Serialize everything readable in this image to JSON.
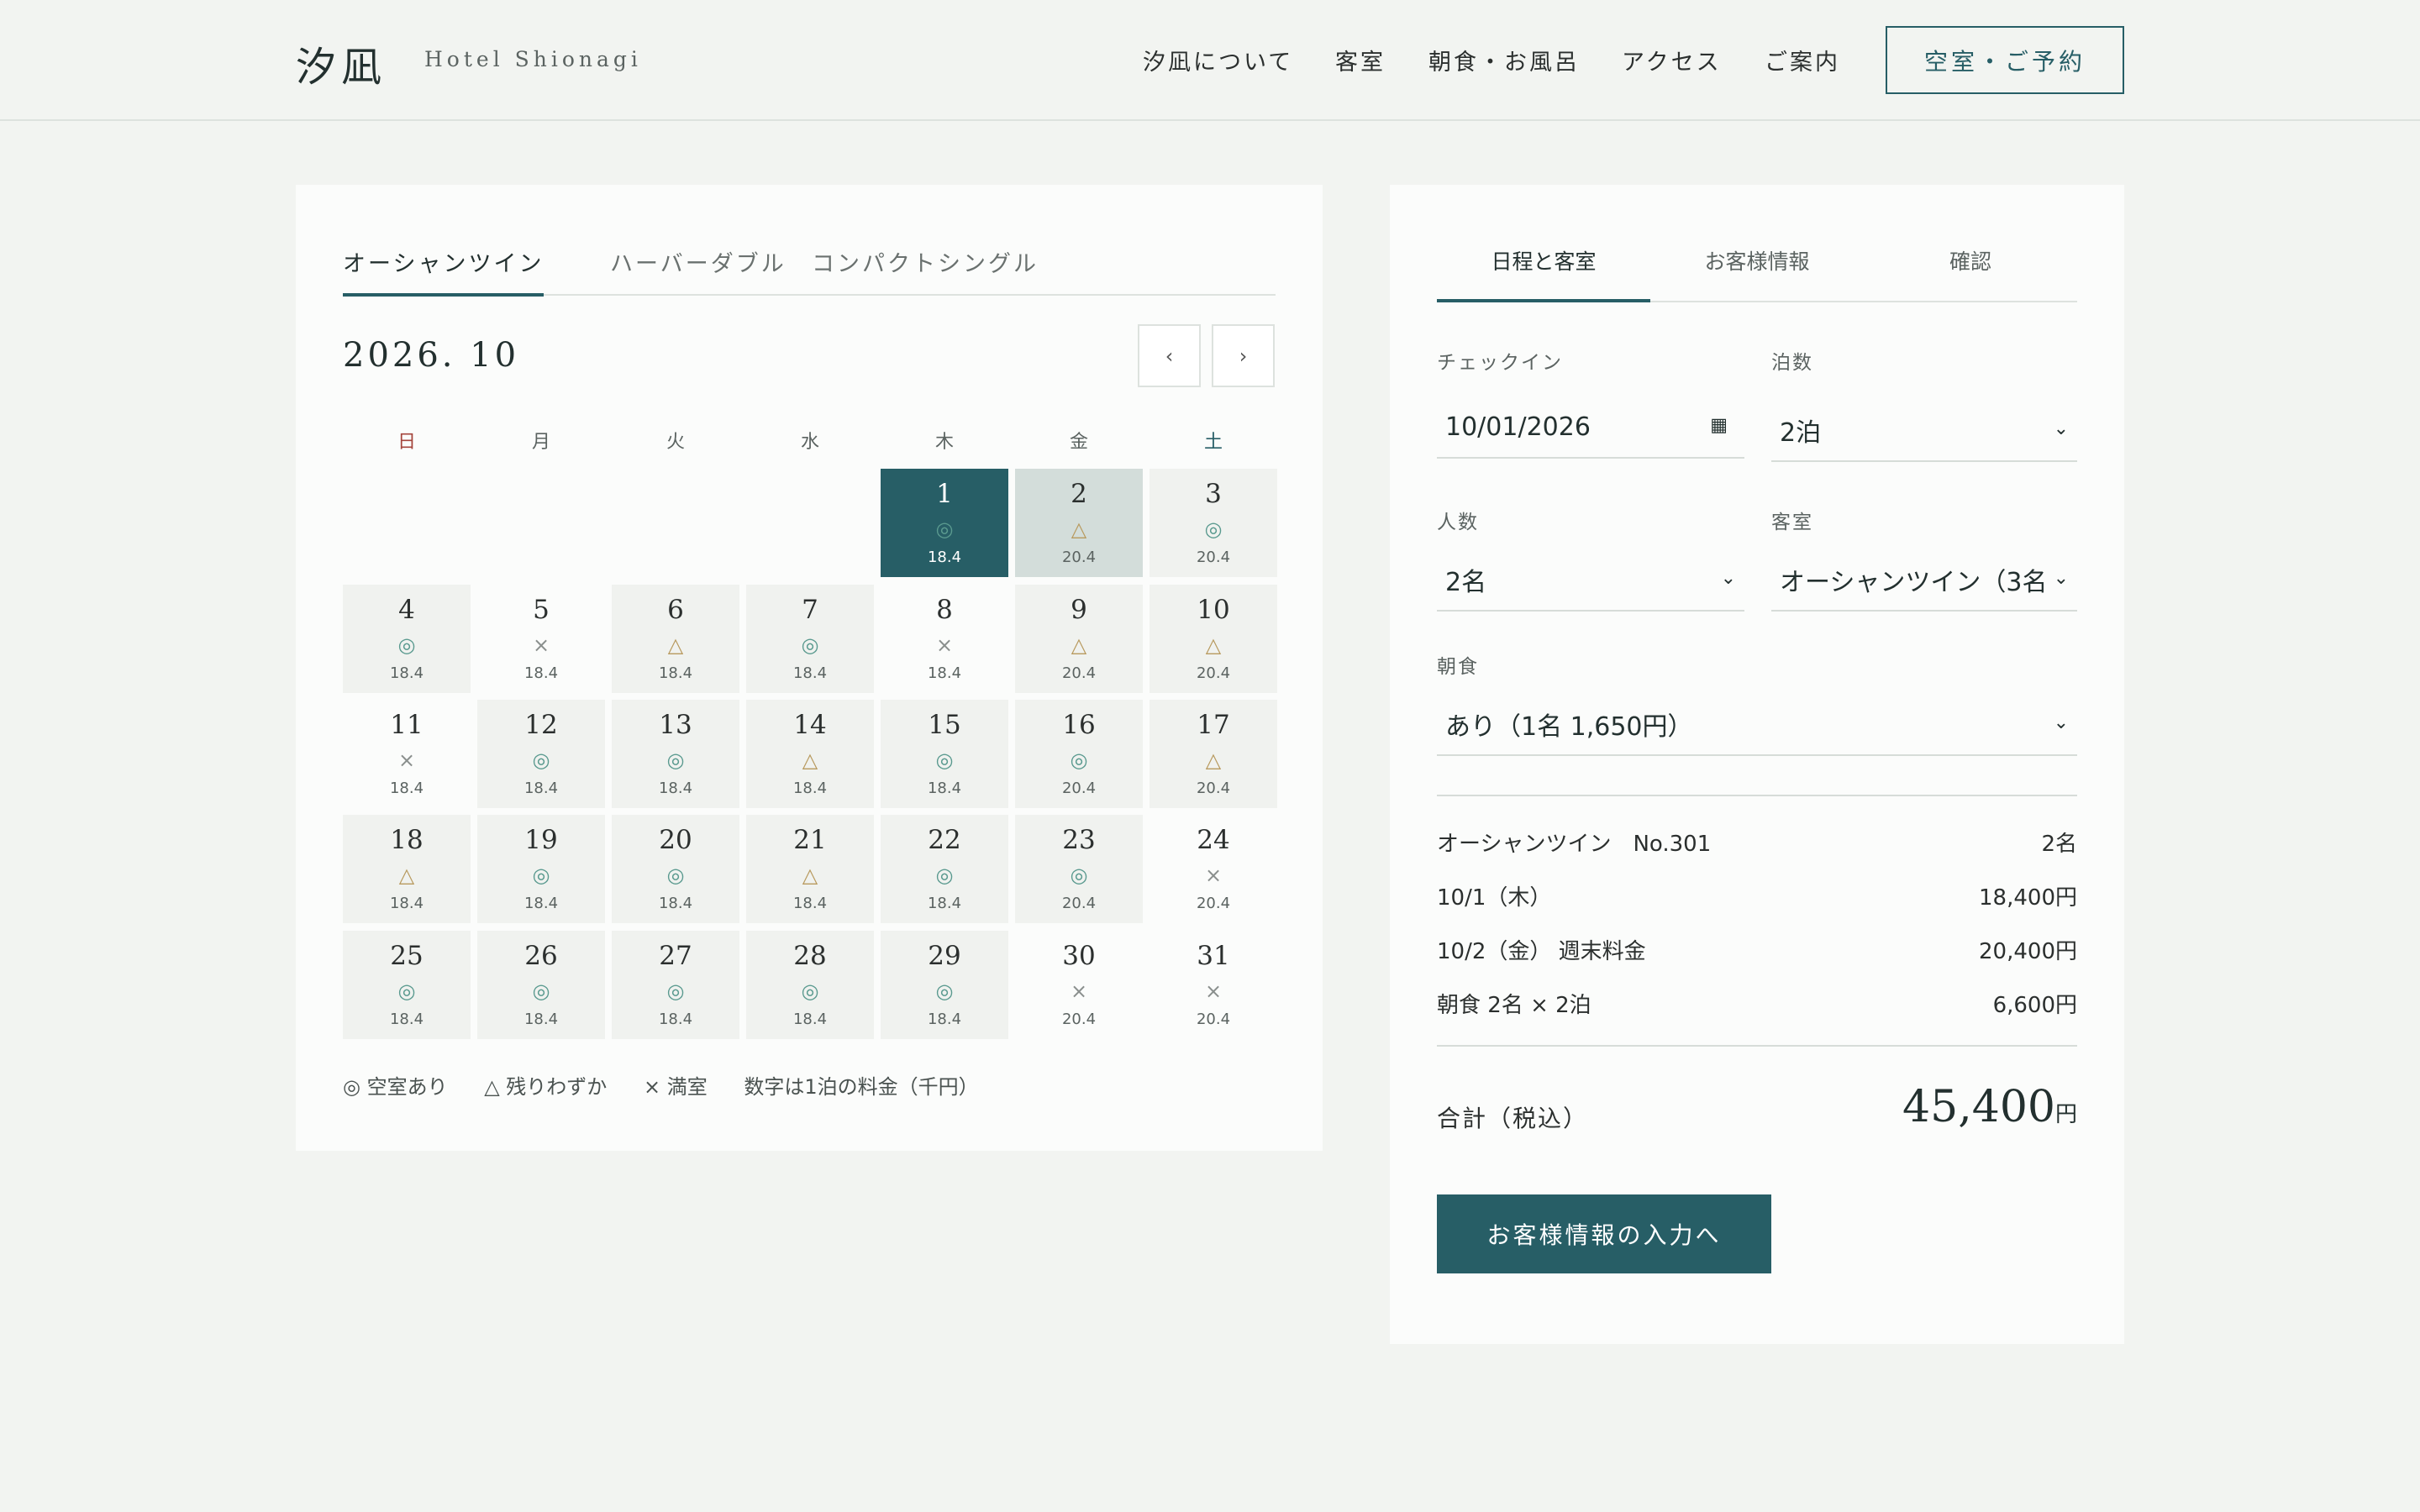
{
  "header": {
    "logo": "汐凪",
    "logo_sub": "Hotel Shionagi",
    "nav": [
      "汐凪について",
      "客室",
      "朝食・お風呂",
      "アクセス",
      "ご案内"
    ],
    "reserve": "空室・ご予約"
  },
  "calendar": {
    "room_tabs": [
      "オーシャンツイン",
      "ハーバーダブル",
      "コンパクトシングル"
    ],
    "month": "2026. 10",
    "prev": "‹",
    "next": "›",
    "weekdays": [
      "日",
      "月",
      "火",
      "水",
      "木",
      "金",
      "土"
    ],
    "days": [
      {
        "d": "1",
        "s": "◎",
        "p": "18.4",
        "state": "sel"
      },
      {
        "d": "2",
        "s": "△",
        "p": "20.4",
        "state": "range"
      },
      {
        "d": "3",
        "s": "◎",
        "p": "20.4",
        "state": "avail"
      },
      {
        "d": "4",
        "s": "◎",
        "p": "18.4",
        "state": "avail"
      },
      {
        "d": "5",
        "s": "×",
        "p": "18.4",
        "state": "full"
      },
      {
        "d": "6",
        "s": "△",
        "p": "18.4",
        "state": "avail"
      },
      {
        "d": "7",
        "s": "◎",
        "p": "18.4",
        "state": "avail"
      },
      {
        "d": "8",
        "s": "×",
        "p": "18.4",
        "state": "full"
      },
      {
        "d": "9",
        "s": "△",
        "p": "20.4",
        "state": "avail"
      },
      {
        "d": "10",
        "s": "△",
        "p": "20.4",
        "state": "avail"
      },
      {
        "d": "11",
        "s": "×",
        "p": "18.4",
        "state": "full"
      },
      {
        "d": "12",
        "s": "◎",
        "p": "18.4",
        "state": "avail"
      },
      {
        "d": "13",
        "s": "◎",
        "p": "18.4",
        "state": "avail"
      },
      {
        "d": "14",
        "s": "△",
        "p": "18.4",
        "state": "avail"
      },
      {
        "d": "15",
        "s": "◎",
        "p": "18.4",
        "state": "avail"
      },
      {
        "d": "16",
        "s": "◎",
        "p": "20.4",
        "state": "avail"
      },
      {
        "d": "17",
        "s": "△",
        "p": "20.4",
        "state": "avail"
      },
      {
        "d": "18",
        "s": "△",
        "p": "18.4",
        "state": "avail"
      },
      {
        "d": "19",
        "s": "◎",
        "p": "18.4",
        "state": "avail"
      },
      {
        "d": "20",
        "s": "◎",
        "p": "18.4",
        "state": "avail"
      },
      {
        "d": "21",
        "s": "△",
        "p": "18.4",
        "state": "avail"
      },
      {
        "d": "22",
        "s": "◎",
        "p": "18.4",
        "state": "avail"
      },
      {
        "d": "23",
        "s": "◎",
        "p": "20.4",
        "state": "avail"
      },
      {
        "d": "24",
        "s": "×",
        "p": "20.4",
        "state": "full"
      },
      {
        "d": "25",
        "s": "◎",
        "p": "18.4",
        "state": "avail"
      },
      {
        "d": "26",
        "s": "◎",
        "p": "18.4",
        "state": "avail"
      },
      {
        "d": "27",
        "s": "◎",
        "p": "18.4",
        "state": "avail"
      },
      {
        "d": "28",
        "s": "◎",
        "p": "18.4",
        "state": "avail"
      },
      {
        "d": "29",
        "s": "◎",
        "p": "18.4",
        "state": "avail"
      },
      {
        "d": "30",
        "s": "×",
        "p": "20.4",
        "state": "full"
      },
      {
        "d": "31",
        "s": "×",
        "p": "20.4",
        "state": "full"
      }
    ],
    "first_weekday": 4,
    "legend": [
      "◎ 空室あり",
      "△ 残りわずか",
      "× 満室",
      "数字は1泊の料金（千円）"
    ],
    "colors": {
      "ok": "#5a9a8f",
      "few": "#b89a5e",
      "full": "#8a8f8d",
      "sun": "#a4453c",
      "sat": "#275e66"
    }
  },
  "booking": {
    "steps": [
      "日程と客室",
      "お客様情報",
      "確認"
    ],
    "checkin_label": "チェックイン",
    "checkin_value": "10/01/2026",
    "nights_label": "泊数",
    "nights_value": "2泊",
    "guests_label": "人数",
    "guests_value": "2名",
    "room_label": "客室",
    "room_value": "オーシャンツイン（3名",
    "breakfast_label": "朝食",
    "breakfast_value": "あり（1名 1,650円）",
    "summary": [
      {
        "l": "オーシャンツイン　No.301",
        "r": "2名"
      },
      {
        "l": "10/1（木）",
        "r": "18,400円"
      },
      {
        "l": "10/2（金） 週末料金",
        "r": "20,400円"
      },
      {
        "l": "朝食 2名 × 2泊",
        "r": "6,600円"
      }
    ],
    "total_label": "合計（税込）",
    "total_value": "45,400",
    "total_unit": "円",
    "next": "お客様情報の入力へ"
  }
}
